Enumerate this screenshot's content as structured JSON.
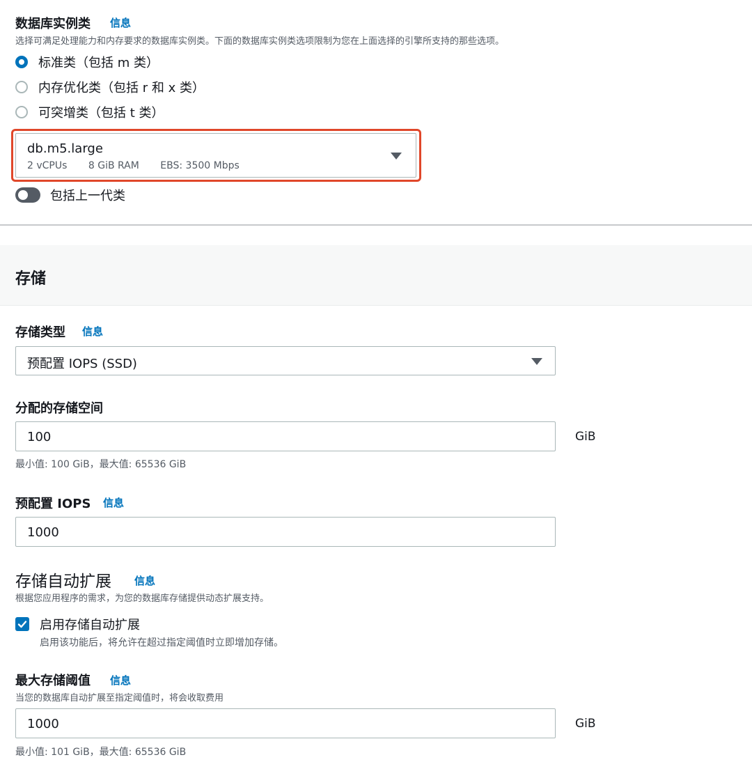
{
  "instance_class": {
    "title": "数据库实例类",
    "info": "信息",
    "description": "选择可满足处理能力和内存要求的数据库实例类。下面的数据库实例类选项限制为您在上面选择的引擎所支持的那些选项。",
    "options": [
      {
        "label": "标准类（包括 m 类）",
        "checked": true
      },
      {
        "label": "内存优化类（包括 r 和 x 类）",
        "checked": false
      },
      {
        "label": "可突增类（包括 t 类）",
        "checked": false
      }
    ],
    "selected": {
      "name": "db.m5.large",
      "vcpus": "2 vCPUs",
      "ram": "8 GiB RAM",
      "ebs": "EBS: 3500 Mbps"
    },
    "toggle_label": "包括上一代类",
    "toggle_on": false,
    "highlight_color": "#e0472a"
  },
  "storage": {
    "section_title": "存储",
    "type": {
      "label": "存储类型",
      "info": "信息",
      "value": "预配置 IOPS (SSD)"
    },
    "allocated": {
      "label": "分配的存储空间",
      "value": "100",
      "unit": "GiB",
      "hint": "最小值: 100 GiB，最大值: 65536 GiB"
    },
    "iops": {
      "label": "预配置 IOPS",
      "info": "信息",
      "value": "1000"
    },
    "autoscaling": {
      "title": "存储自动扩展",
      "info": "信息",
      "description": "根据您应用程序的需求，为您的数据库存储提供动态扩展支持。",
      "checkbox_label": "启用存储自动扩展",
      "checkbox_checked": true,
      "checkbox_hint": "启用该功能后，将允许在超过指定阈值时立即增加存储。"
    },
    "max_threshold": {
      "label": "最大存储阈值",
      "info": "信息",
      "description": "当您的数据库自动扩展至指定阈值时，将会收取费用",
      "value": "1000",
      "unit": "GiB",
      "hint": "最小值: 101 GiB，最大值: 65536 GiB"
    }
  },
  "colors": {
    "accent": "#0073bb",
    "border": "#aab7b8",
    "section_bg": "#f7f8f8"
  }
}
